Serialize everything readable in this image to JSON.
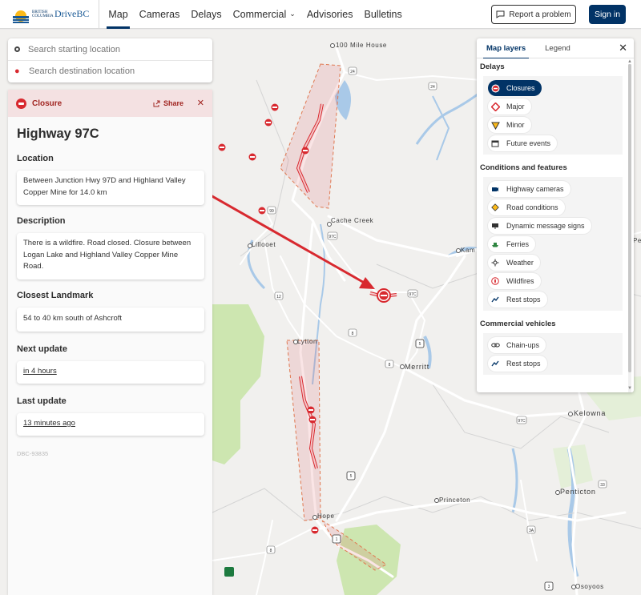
{
  "header": {
    "logo_gov_text": "BRITISH COLUMBIA",
    "logo_text": "DriveBC",
    "nav": [
      {
        "label": "Map",
        "active": true
      },
      {
        "label": "Cameras"
      },
      {
        "label": "Delays"
      },
      {
        "label": "Commercial"
      },
      {
        "label": "Advisories"
      },
      {
        "label": "Bulletins"
      }
    ],
    "report_label": "Report a problem",
    "signin_label": "Sign in"
  },
  "search": {
    "start_placeholder": "Search starting location",
    "dest_placeholder": "Search destination location"
  },
  "panel": {
    "type_label": "Closure",
    "share_label": "Share",
    "title": "Highway 97C",
    "location_heading": "Location",
    "location_text": "Between Junction Hwy 97D and Highland Valley Copper Mine for 14.0 km",
    "description_heading": "Description",
    "description_text": "There is a wildfire. Road closed. Closure between Logan Lake and Highland Valley Copper Mine Road.",
    "landmark_heading": "Closest Landmark",
    "landmark_text": "54 to 40 km south of Ashcroft",
    "next_update_heading": "Next update",
    "next_update_text": "in 4 hours",
    "last_update_heading": "Last update",
    "last_update_text": "13 minutes ago",
    "event_id": "DBC-93835"
  },
  "layers": {
    "tabs": [
      "Map layers",
      "Legend"
    ],
    "groups": [
      {
        "title": "Delays",
        "items": [
          {
            "label": "Closures",
            "icon": "closure-icon",
            "on": true
          },
          {
            "label": "Major",
            "icon": "major-icon"
          },
          {
            "label": "Minor",
            "icon": "minor-icon"
          },
          {
            "label": "Future events",
            "icon": "calendar-icon"
          }
        ]
      },
      {
        "title": "Conditions and features",
        "items": [
          {
            "label": "Highway cameras",
            "icon": "camera-icon"
          },
          {
            "label": "Road conditions",
            "icon": "road-conditions-icon"
          },
          {
            "label": "Dynamic message signs",
            "icon": "message-sign-icon"
          },
          {
            "label": "Ferries",
            "icon": "ferry-icon"
          },
          {
            "label": "Weather",
            "icon": "weather-icon"
          },
          {
            "label": "Wildfires",
            "icon": "wildfire-icon"
          },
          {
            "label": "Rest stops",
            "icon": "rest-stop-icon"
          }
        ]
      },
      {
        "title": "Commercial vehicles",
        "items": [
          {
            "label": "Chain-ups",
            "icon": "chain-up-icon"
          },
          {
            "label": "Rest stops",
            "icon": "rest-stop-icon"
          }
        ]
      }
    ]
  },
  "map": {
    "places": [
      "100 Mile House",
      "Cache Creek",
      "Lillooet",
      "Kam",
      "Merritt",
      "Lytton",
      "Kelowna",
      "Penticton",
      "Princeton",
      "Hope",
      "Osoyoos",
      "Pe"
    ],
    "highway_shields": [
      "24",
      "24",
      "99",
      "97C",
      "97C",
      "12",
      "8",
      "5",
      "8",
      "97C",
      "5",
      "33",
      "3A",
      "3",
      "1"
    ],
    "colors": {
      "closure": "#d8292f",
      "water": "#a9c9e8",
      "park": "#cde6b0",
      "road": "#ffffff"
    }
  }
}
